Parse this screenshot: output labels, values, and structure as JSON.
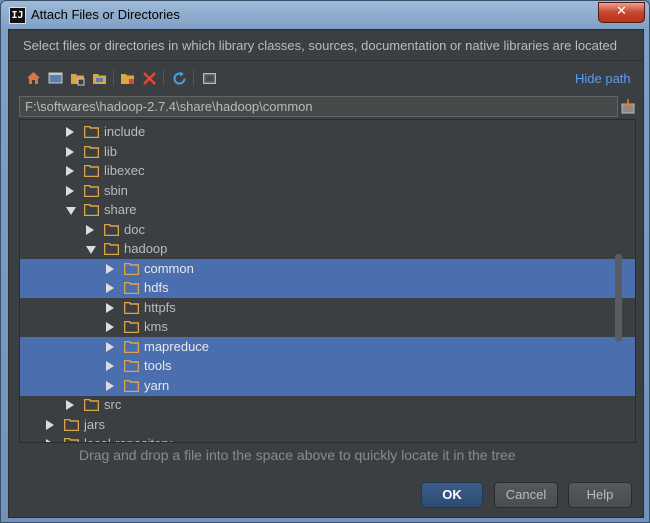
{
  "window": {
    "title": "Attach Files or Directories",
    "app_icon_label": "IJ",
    "close_symbol": "✕"
  },
  "dialog": {
    "description": "Select files or directories in which library classes, sources, documentation or native libraries are located",
    "hide_path": "Hide path",
    "path": "F:\\softwares\\hadoop-2.7.4\\share\\hadoop\\common",
    "hint": "Drag and drop a file into the space above to quickly locate it in the tree"
  },
  "toolbar": {
    "icons": [
      "home-icon",
      "desktop-icon",
      "project-folder-icon",
      "module-folder-icon",
      "new-folder-icon",
      "delete-icon",
      "refresh-icon",
      "show-hidden-icon"
    ]
  },
  "tree": {
    "rows": [
      {
        "label": "include",
        "depth": 3,
        "expanded": false,
        "selected": false
      },
      {
        "label": "lib",
        "depth": 3,
        "expanded": false,
        "selected": false
      },
      {
        "label": "libexec",
        "depth": 3,
        "expanded": false,
        "selected": false
      },
      {
        "label": "sbin",
        "depth": 3,
        "expanded": false,
        "selected": false
      },
      {
        "label": "share",
        "depth": 3,
        "expanded": true,
        "selected": false
      },
      {
        "label": "doc",
        "depth": 4,
        "expanded": false,
        "selected": false
      },
      {
        "label": "hadoop",
        "depth": 4,
        "expanded": true,
        "selected": false
      },
      {
        "label": "common",
        "depth": 5,
        "expanded": false,
        "selected": true
      },
      {
        "label": "hdfs",
        "depth": 5,
        "expanded": false,
        "selected": true
      },
      {
        "label": "httpfs",
        "depth": 5,
        "expanded": false,
        "selected": false
      },
      {
        "label": "kms",
        "depth": 5,
        "expanded": false,
        "selected": false
      },
      {
        "label": "mapreduce",
        "depth": 5,
        "expanded": false,
        "selected": true
      },
      {
        "label": "tools",
        "depth": 5,
        "expanded": false,
        "selected": true
      },
      {
        "label": "yarn",
        "depth": 5,
        "expanded": false,
        "selected": true
      },
      {
        "label": "src",
        "depth": 3,
        "expanded": false,
        "selected": false
      },
      {
        "label": "jars",
        "depth": 2,
        "expanded": false,
        "selected": false
      },
      {
        "label": "local-repository",
        "depth": 2,
        "expanded": false,
        "selected": false
      }
    ]
  },
  "buttons": {
    "ok": "OK",
    "cancel": "Cancel",
    "help": "Help"
  },
  "colors": {
    "selection": "#4b6eaf",
    "folder": "#d9a54a",
    "link": "#589df6"
  }
}
